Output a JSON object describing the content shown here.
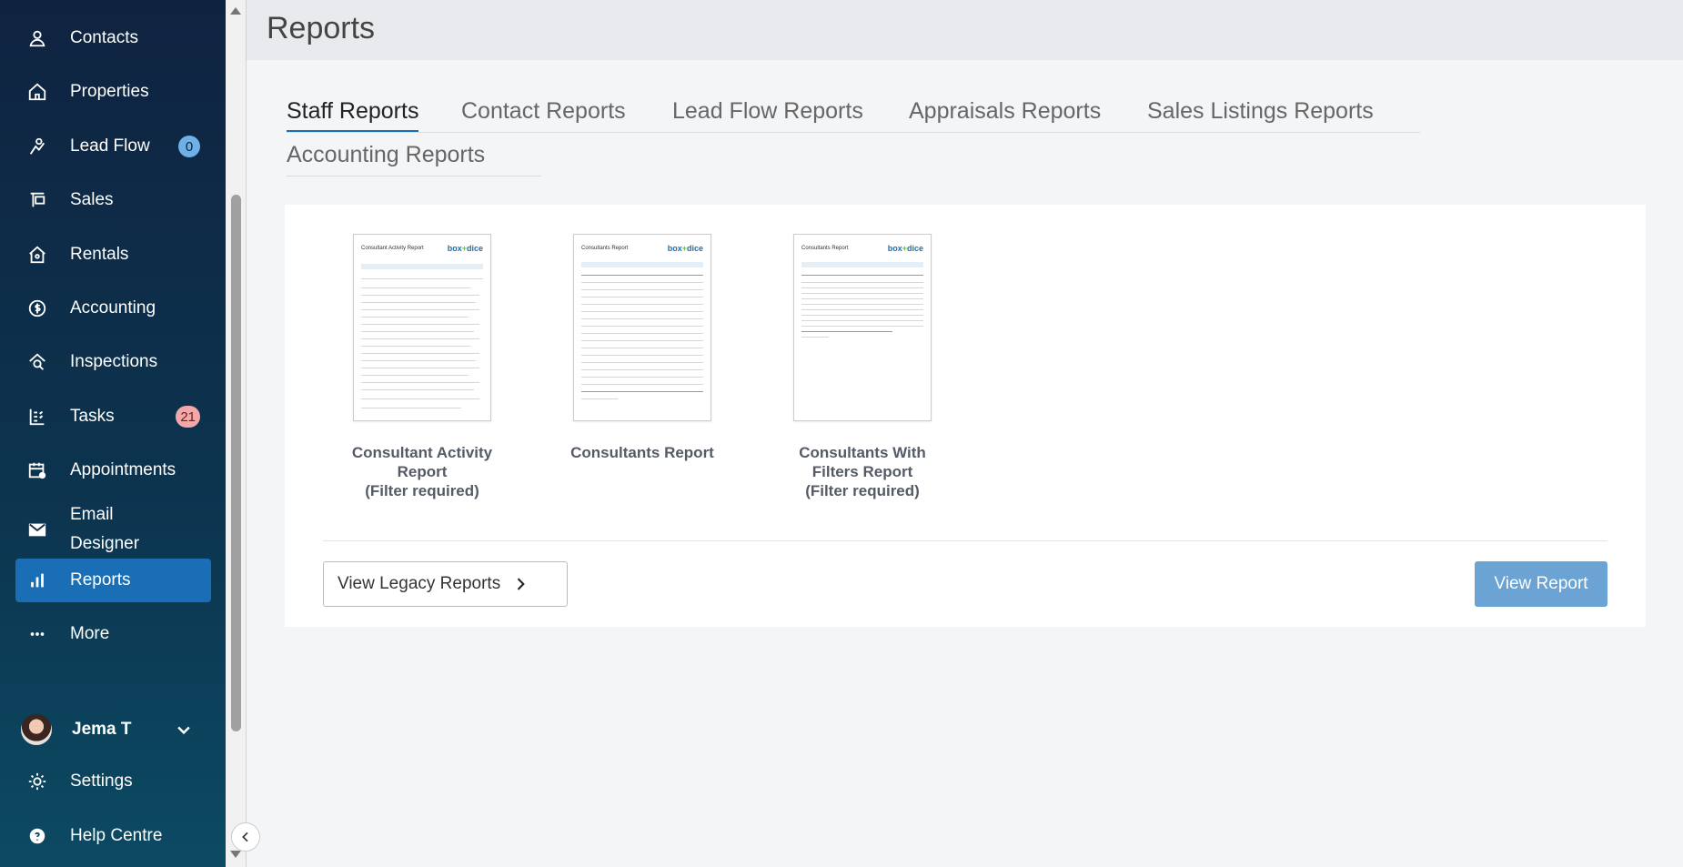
{
  "sidebar": {
    "items": [
      {
        "label": "Contacts",
        "icon": "person-icon"
      },
      {
        "label": "Properties",
        "icon": "house-icon"
      },
      {
        "label": "Lead Flow",
        "icon": "lead-flow-icon",
        "badge": "0"
      },
      {
        "label": "Sales",
        "icon": "sign-icon"
      },
      {
        "label": "Rentals",
        "icon": "key-house-icon"
      },
      {
        "label": "Accounting",
        "icon": "dollar-icon"
      },
      {
        "label": "Inspections",
        "icon": "inspection-icon"
      },
      {
        "label": "Tasks",
        "icon": "tasks-icon",
        "badge": "21"
      },
      {
        "label": "Appointments",
        "icon": "calendar-icon"
      },
      {
        "label": "Email\nDesigner",
        "icon": "envelope-icon"
      },
      {
        "label": "Reports",
        "icon": "bar-chart-icon",
        "active": true
      },
      {
        "label": "More",
        "icon": "dots-icon"
      }
    ],
    "user": {
      "name": "Jema T"
    },
    "settings_label": "Settings",
    "help_label": "Help Centre"
  },
  "page": {
    "title": "Reports"
  },
  "tabs": [
    {
      "label": "Staff Reports",
      "active": true
    },
    {
      "label": "Contact Reports"
    },
    {
      "label": "Lead Flow Reports"
    },
    {
      "label": "Appraisals Reports"
    },
    {
      "label": "Sales Listings Reports"
    },
    {
      "label": "Accounting Reports"
    }
  ],
  "reports": [
    {
      "name": "Consultant Activity\nReport\n(Filter required)",
      "thumb_title": "Consultant Activity Report"
    },
    {
      "name": "Consultants Report",
      "thumb_title": "Consultants Report"
    },
    {
      "name": "Consultants With\nFilters Report\n(Filter required)",
      "thumb_title": "Consultants Report"
    }
  ],
  "thumb_logo": {
    "brand": "box",
    "mark": "+",
    "suffix": "dice"
  },
  "buttons": {
    "legacy": "View Legacy Reports",
    "view": "View Report"
  },
  "colors": {
    "accent": "#1a6eb5",
    "view_button": "#6aa3d4",
    "sidebar": "#0f2340"
  }
}
